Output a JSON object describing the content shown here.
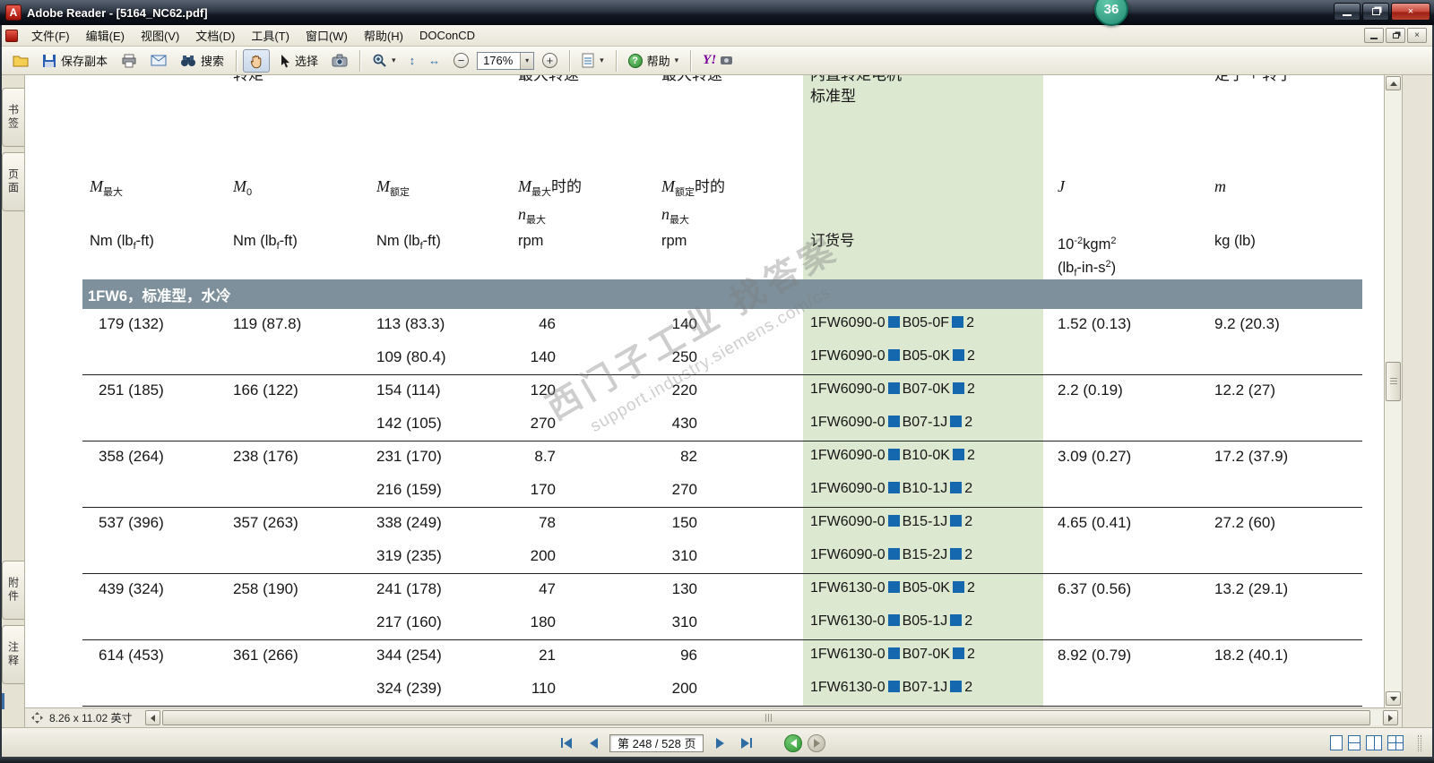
{
  "window": {
    "title": "Adobe Reader - [5164_NC62.pdf]",
    "badge": "36"
  },
  "icons": {
    "caret": "▾",
    "close_glyph": "×"
  },
  "menu": {
    "items": [
      "文件(F)",
      "编辑(E)",
      "视图(V)",
      "文档(D)",
      "工具(T)",
      "窗口(W)",
      "帮助(H)",
      "DOConCD"
    ]
  },
  "toolbar": {
    "save_label": "保存副本",
    "search_label": "搜索",
    "select_label": "选择",
    "zoom_value": "176%",
    "help_label": "帮助",
    "yahoo_label": "Y!"
  },
  "sidebar": {
    "top_tabs": [
      "书签",
      "页面"
    ],
    "bottom_tabs": [
      "附件",
      "注释"
    ]
  },
  "statusbar": {
    "page_size": "8.26 x 11.02 英寸"
  },
  "navbar": {
    "page_indicator": "第 248 / 528 页"
  },
  "watermark": {
    "line1": "西门子工业 找答案",
    "line2": "support.industry.siemens.com/cs"
  },
  "table": {
    "section_title": "1FW6，标准型，水冷",
    "head": {
      "cut": {
        "col2": "转矩",
        "col4": "最大转速",
        "col5": "最大转速",
        "col6a": "内置转矩电机",
        "col6b": "标准型",
        "col8": "定子 + 转子"
      },
      "m": {
        "c1": [
          {
            "t": "M",
            "i": 1
          },
          {
            "t": "最大",
            "sub": 1
          }
        ],
        "c2": [
          {
            "t": "M",
            "i": 1
          },
          {
            "t": "0",
            "sub": 1
          }
        ],
        "c3": [
          {
            "t": "M",
            "i": 1
          },
          {
            "t": "额定",
            "sub": 1
          }
        ],
        "c4a": [
          {
            "t": "M",
            "i": 1
          },
          {
            "t": "最大",
            "sub": 1
          },
          {
            "t": "时的"
          }
        ],
        "c4b": [
          {
            "t": "n",
            "i": 1
          },
          {
            "t": "最大",
            "sub": 1
          }
        ],
        "c5a": [
          {
            "t": "M",
            "i": 1
          },
          {
            "t": "额定",
            "sub": 1
          },
          {
            "t": "时的"
          }
        ],
        "c5b": [
          {
            "t": "n",
            "i": 1
          },
          {
            "t": "最大",
            "sub": 1
          }
        ],
        "c7": [
          {
            "t": "J",
            "i": 1
          }
        ],
        "c8": [
          {
            "t": "m",
            "i": 1
          }
        ]
      },
      "units": {
        "c1": [
          {
            "t": "Nm (lb"
          },
          {
            "t": "f",
            "sub": 1
          },
          {
            "t": "-ft)"
          }
        ],
        "c2": [
          {
            "t": "Nm (lb"
          },
          {
            "t": "f",
            "sub": 1
          },
          {
            "t": "-ft)"
          }
        ],
        "c3": [
          {
            "t": "Nm (lb"
          },
          {
            "t": "f",
            "sub": 1
          },
          {
            "t": "-ft)"
          }
        ],
        "c4": [
          {
            "t": "rpm"
          }
        ],
        "c5": [
          {
            "t": "rpm"
          }
        ],
        "c6": [
          {
            "t": "订货号"
          }
        ],
        "c7a": [
          {
            "t": "10"
          },
          {
            "t": "-2",
            "sup": 1
          },
          {
            "t": "kgm"
          },
          {
            "t": "2",
            "sup": 1
          }
        ],
        "c7b": [
          {
            "t": "(lb"
          },
          {
            "t": "f",
            "sub": 1
          },
          {
            "t": "-in-s"
          },
          {
            "t": "2",
            "sup": 1
          },
          {
            "t": ")"
          }
        ],
        "c8": [
          {
            "t": "kg (lb)"
          }
        ]
      }
    },
    "rows": [
      {
        "m_max": "179 (132)",
        "m0": "119 (87.8)",
        "j": "1.52 (0.13)",
        "mass": "9.2 (20.3)",
        "subrows": [
          {
            "m_rated": "113 (83.3)",
            "rpm_at_m_max": "46",
            "rpm_at_m_rated": "140",
            "order": [
              "1FW6090-0",
              "B05-0F",
              "2"
            ]
          },
          {
            "m_rated": "109 (80.4)",
            "rpm_at_m_max": "140",
            "rpm_at_m_rated": "250",
            "order": [
              "1FW6090-0",
              "B05-0K",
              "2"
            ]
          }
        ]
      },
      {
        "m_max": "251 (185)",
        "m0": "166 (122)",
        "j": "2.2 (0.19)",
        "mass": "12.2 (27)",
        "subrows": [
          {
            "m_rated": "154 (114)",
            "rpm_at_m_max": "120",
            "rpm_at_m_rated": "220",
            "order": [
              "1FW6090-0",
              "B07-0K",
              "2"
            ]
          },
          {
            "m_rated": "142 (105)",
            "rpm_at_m_max": "270",
            "rpm_at_m_rated": "430",
            "order": [
              "1FW6090-0",
              "B07-1J",
              "2"
            ]
          }
        ]
      },
      {
        "m_max": "358 (264)",
        "m0": "238 (176)",
        "j": "3.09 (0.27)",
        "mass": "17.2 (37.9)",
        "subrows": [
          {
            "m_rated": "231 (170)",
            "rpm_at_m_max": "8.7",
            "rpm_at_m_rated": "82",
            "order": [
              "1FW6090-0",
              "B10-0K",
              "2"
            ]
          },
          {
            "m_rated": "216 (159)",
            "rpm_at_m_max": "170",
            "rpm_at_m_rated": "270",
            "order": [
              "1FW6090-0",
              "B10-1J",
              "2"
            ]
          }
        ]
      },
      {
        "m_max": "537 (396)",
        "m0": "357 (263)",
        "j": "4.65 (0.41)",
        "mass": "27.2 (60)",
        "subrows": [
          {
            "m_rated": "338 (249)",
            "rpm_at_m_max": "78",
            "rpm_at_m_rated": "150",
            "order": [
              "1FW6090-0",
              "B15-1J",
              "2"
            ]
          },
          {
            "m_rated": "319 (235)",
            "rpm_at_m_max": "200",
            "rpm_at_m_rated": "310",
            "order": [
              "1FW6090-0",
              "B15-2J",
              "2"
            ]
          }
        ]
      },
      {
        "m_max": "439 (324)",
        "m0": "258 (190)",
        "j": "6.37 (0.56)",
        "mass": "13.2 (29.1)",
        "subrows": [
          {
            "m_rated": "241 (178)",
            "rpm_at_m_max": "47",
            "rpm_at_m_rated": "130",
            "order": [
              "1FW6130-0",
              "B05-0K",
              "2"
            ]
          },
          {
            "m_rated": "217 (160)",
            "rpm_at_m_max": "180",
            "rpm_at_m_rated": "310",
            "order": [
              "1FW6130-0",
              "B05-1J",
              "2"
            ]
          }
        ]
      },
      {
        "m_max": "614 (453)",
        "m0": "361 (266)",
        "j": "8.92 (0.79)",
        "mass": "18.2 (40.1)",
        "subrows": [
          {
            "m_rated": "344 (254)",
            "rpm_at_m_max": "21",
            "rpm_at_m_rated": "96",
            "order": [
              "1FW6130-0",
              "B07-0K",
              "2"
            ]
          },
          {
            "m_rated": "324 (239)",
            "rpm_at_m_max": "110",
            "rpm_at_m_rated": "200",
            "order": [
              "1FW6130-0",
              "B07-1J",
              "2"
            ]
          }
        ]
      }
    ]
  }
}
